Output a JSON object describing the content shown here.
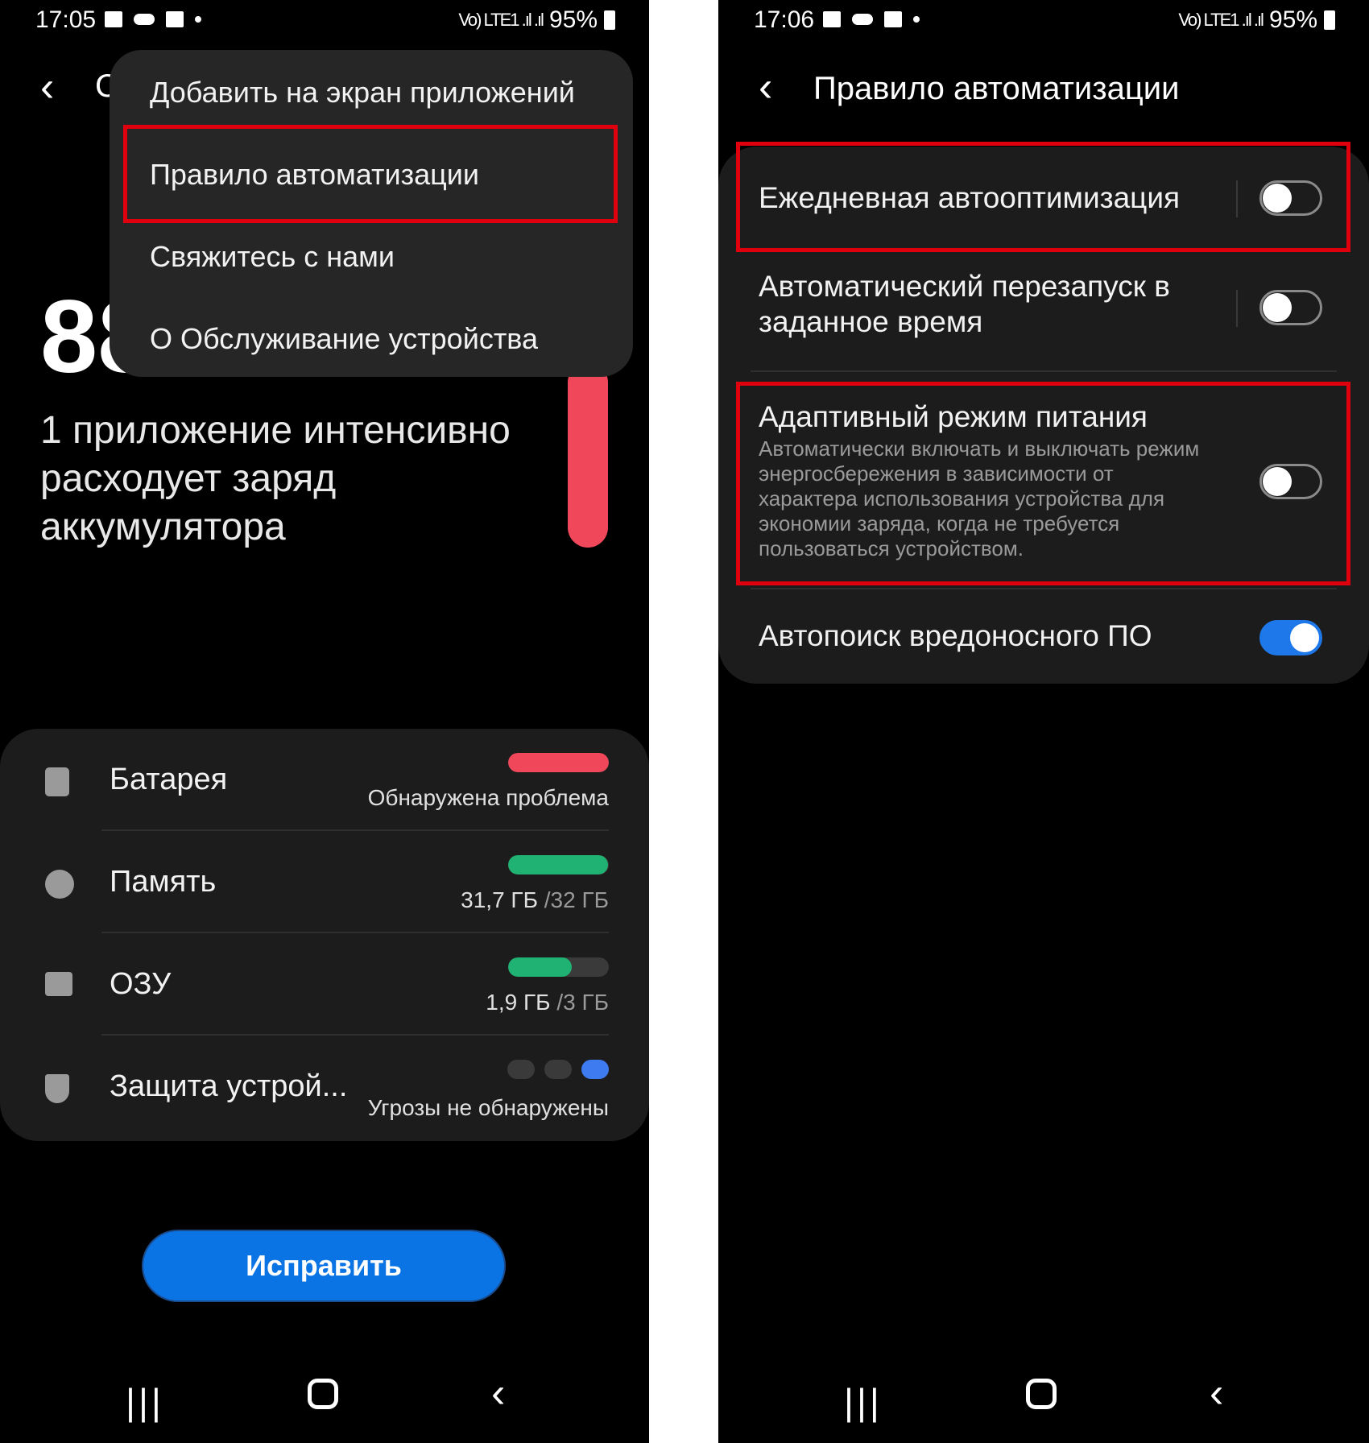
{
  "left_screen": {
    "status": {
      "time": "17:05",
      "battery": "95%",
      "signal": "Vo) LTE1 .ıl .ıl"
    },
    "title_partial": "С",
    "big_number": "88",
    "warning_text": "1 приложение интенсивно расходует заряд аккумулятора",
    "menu": {
      "items": [
        {
          "label": "Добавить на экран приложений"
        },
        {
          "label": "Правило автоматизации"
        },
        {
          "label": "Свяжитесь с нами"
        },
        {
          "label": "О Обслуживание устройства"
        }
      ]
    },
    "status_rows": [
      {
        "label": "Батарея",
        "value": "Обнаружена проблема",
        "bar_fraction": 1.0,
        "bar_color": "#f0485a"
      },
      {
        "label": "Память",
        "value_main": "31,7 ГБ",
        "value_dim": "/32 ГБ",
        "bar_fraction": 0.99,
        "bar_color": "#1fb273"
      },
      {
        "label": "ОЗУ",
        "value_main": "1,9 ГБ",
        "value_dim": "/3 ГБ",
        "bar_fraction": 0.63,
        "bar_color": "#1fb273"
      },
      {
        "label": "Защита устрой...",
        "value": "Угрозы не обнаружены"
      }
    ],
    "fix_button": "Исправить"
  },
  "right_screen": {
    "status": {
      "time": "17:06",
      "battery": "95%",
      "signal": "Vo) LTE1 .ıl .ıl"
    },
    "title": "Правило автоматизации",
    "settings": [
      {
        "label": "Ежедневная автооптимизация",
        "enabled": false
      },
      {
        "label": "Автоматический перезапуск в заданное время",
        "enabled": false
      },
      {
        "label": "Адаптивный режим питания",
        "description": "Автоматически включать и выключать режим энергосбережения в зависимости от характера использования устройства для экономии заряда, когда не требуется пользоваться устройством.",
        "enabled": false
      },
      {
        "label": "Автопоиск вредоносного ПО",
        "enabled": true
      }
    ]
  },
  "colors": {
    "highlight": "#e0000d",
    "accent": "#0b74e4",
    "problem": "#f0485a",
    "ok": "#1fb273"
  }
}
